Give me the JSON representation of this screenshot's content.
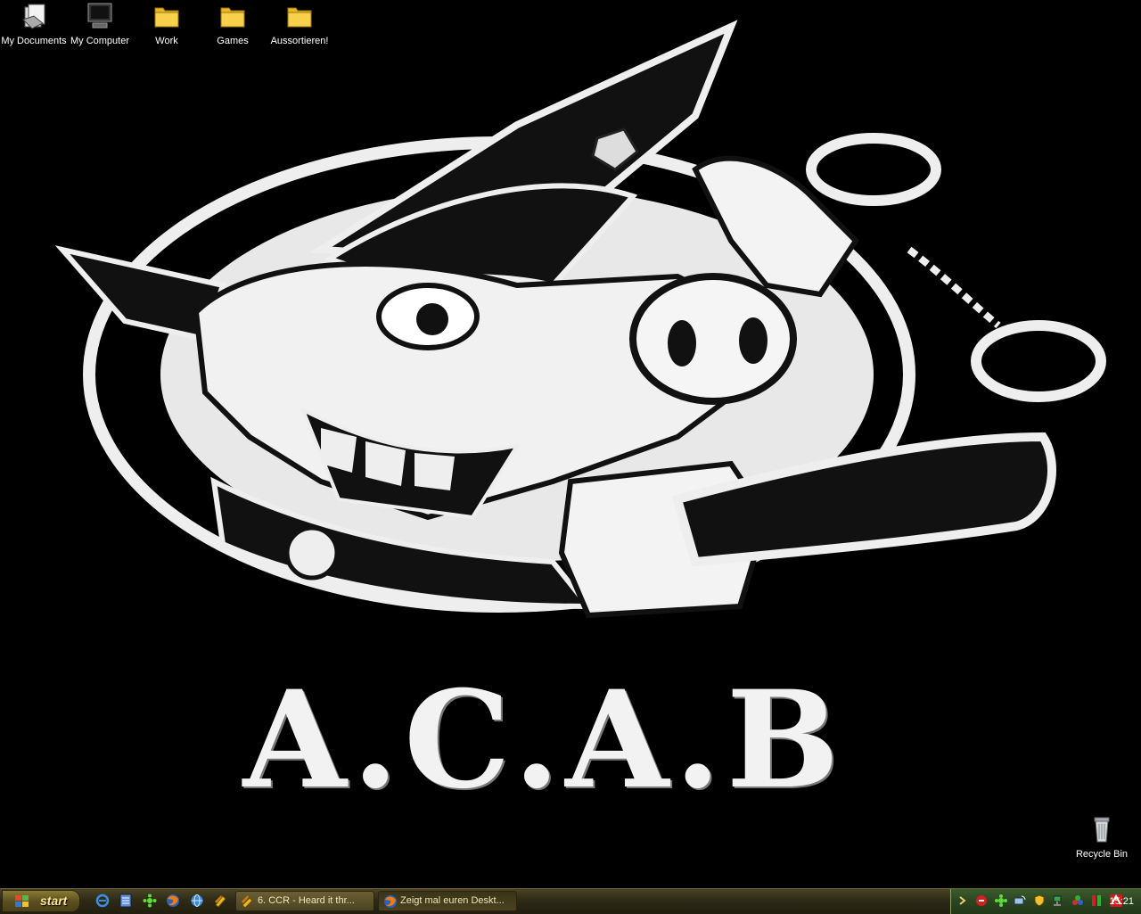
{
  "desktop": {
    "icons": [
      {
        "label": "My Documents"
      },
      {
        "label": "My Computer"
      },
      {
        "label": "Work"
      },
      {
        "label": "Games"
      },
      {
        "label": "Aussortieren!"
      }
    ],
    "recycle_bin": {
      "label": "Recycle Bin"
    },
    "wallpaper_text": "A.C.A.B"
  },
  "taskbar": {
    "start_label": "start",
    "quicklaunch_icons": [
      "ie-icon",
      "notepad-icon",
      "winamp-icon",
      "firefox-icon",
      "network-icon",
      "winrar-icon"
    ],
    "tasks": [
      {
        "label": "6. CCR - Heard it thr...",
        "icon": "media-player-icon",
        "active": false
      },
      {
        "label": "Zeigt mal euren Deskt...",
        "icon": "firefox-icon",
        "active": true
      }
    ],
    "tray": {
      "clock": "15:21"
    }
  },
  "colors": {
    "taskbar": "#2e2a16",
    "tray": "#2b4420",
    "start_text": "#ffe98a"
  }
}
